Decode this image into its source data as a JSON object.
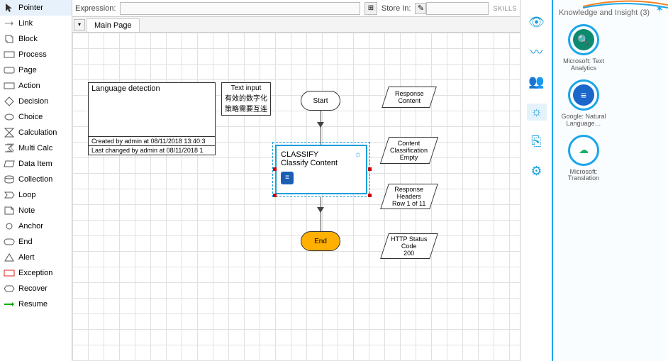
{
  "toolbox": {
    "items": [
      {
        "icon": "pointer",
        "label": "Pointer",
        "selected": true
      },
      {
        "icon": "link",
        "label": "Link"
      },
      {
        "icon": "block",
        "label": "Block"
      },
      {
        "icon": "process",
        "label": "Process"
      },
      {
        "icon": "page",
        "label": "Page"
      },
      {
        "icon": "action",
        "label": "Action"
      },
      {
        "icon": "decision",
        "label": "Decision"
      },
      {
        "icon": "choice",
        "label": "Choice"
      },
      {
        "icon": "calc",
        "label": "Calculation"
      },
      {
        "icon": "multicalc",
        "label": "Multi Calc"
      },
      {
        "icon": "dataitem",
        "label": "Data Item"
      },
      {
        "icon": "collection",
        "label": "Collection"
      },
      {
        "icon": "loop",
        "label": "Loop"
      },
      {
        "icon": "note",
        "label": "Note"
      },
      {
        "icon": "anchor",
        "label": "Anchor"
      },
      {
        "icon": "end",
        "label": "End"
      },
      {
        "icon": "alert",
        "label": "Alert"
      },
      {
        "icon": "exception",
        "label": "Exception"
      },
      {
        "icon": "recover",
        "label": "Recover"
      },
      {
        "icon": "resume",
        "label": "Resume"
      }
    ]
  },
  "exprBar": {
    "exprLabel": "Expression:",
    "exprValue": "",
    "calcGlyph": "⊞",
    "storeLabel": "Store In:",
    "storeValue": "",
    "skillsLabel": "SKILLS"
  },
  "tabs": {
    "dropdownGlyph": "▾",
    "mainTab": "Main Page"
  },
  "canvas": {
    "info": {
      "title": "Language detection",
      "foot1": "Created  by  admin  at  08/11/2018 13:40:3",
      "foot2": "Last changed  by  admin  at  08/11/2018 1"
    },
    "textInput": "Text input\n有效的数字化\n策略需要互连",
    "start": "Start",
    "classify": {
      "title1": "CLASSIFY",
      "title2": "Classify Content"
    },
    "end": "End",
    "responseContent": "Response\nContent",
    "classification": "Content\nClassification\nEmpty",
    "responseHeaders": "Response\nHeaders\nRow 1 of 11",
    "httpStatus": "HTTP Status\nCode\n200"
  },
  "rail": {
    "items": [
      {
        "name": "eye",
        "active": false
      },
      {
        "name": "graph",
        "active": false
      },
      {
        "name": "people",
        "active": false
      },
      {
        "name": "bulb",
        "active": true
      },
      {
        "name": "translate",
        "active": false
      },
      {
        "name": "robot",
        "active": false
      }
    ]
  },
  "skillsPanel": {
    "title": "Knowledge and Insight",
    "count": "(3)",
    "skills": [
      {
        "name": "Microsoft: Text Analytics",
        "color": "#0d8a6f",
        "glyph": "🔍"
      },
      {
        "name": "Google: Natural Language…",
        "color": "#1a66c9",
        "glyph": "≡"
      },
      {
        "name": "Microsoft: Translation",
        "color": "#ffffff",
        "glyph": "☁",
        "text": "#1cae68"
      }
    ]
  }
}
